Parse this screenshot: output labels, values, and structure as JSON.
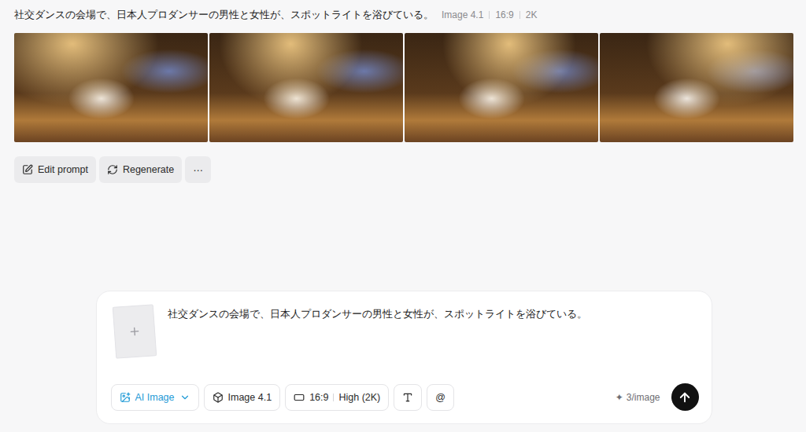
{
  "header": {
    "prompt": "社交ダンスの会場で、日本人プロダンサーの男性と女性が、スポットライトを浴びている。",
    "meta": [
      "Image 4.1",
      "16:9",
      "2K"
    ]
  },
  "images": [
    {
      "kind": "photo"
    },
    {
      "kind": "photo"
    },
    {
      "kind": "photo"
    },
    {
      "kind": "photo"
    }
  ],
  "actions": [
    {
      "label": "Edit prompt",
      "kind": "edit"
    },
    {
      "label": "Regenerate",
      "kind": "regenerate"
    },
    {
      "label": "⋯",
      "kind": "more"
    }
  ],
  "composer": {
    "prompt": "社交ダンスの会場で、日本人プロダンサーの男性と女性が、スポットライトを浴びている。",
    "mode": {
      "label": "AI Image",
      "selected": true
    },
    "model": "Image 4.1",
    "aspect": "16:9",
    "quality": "High (2K)",
    "mention": "@",
    "credits": {
      "symbol": "✦",
      "text": "3/image"
    }
  }
}
